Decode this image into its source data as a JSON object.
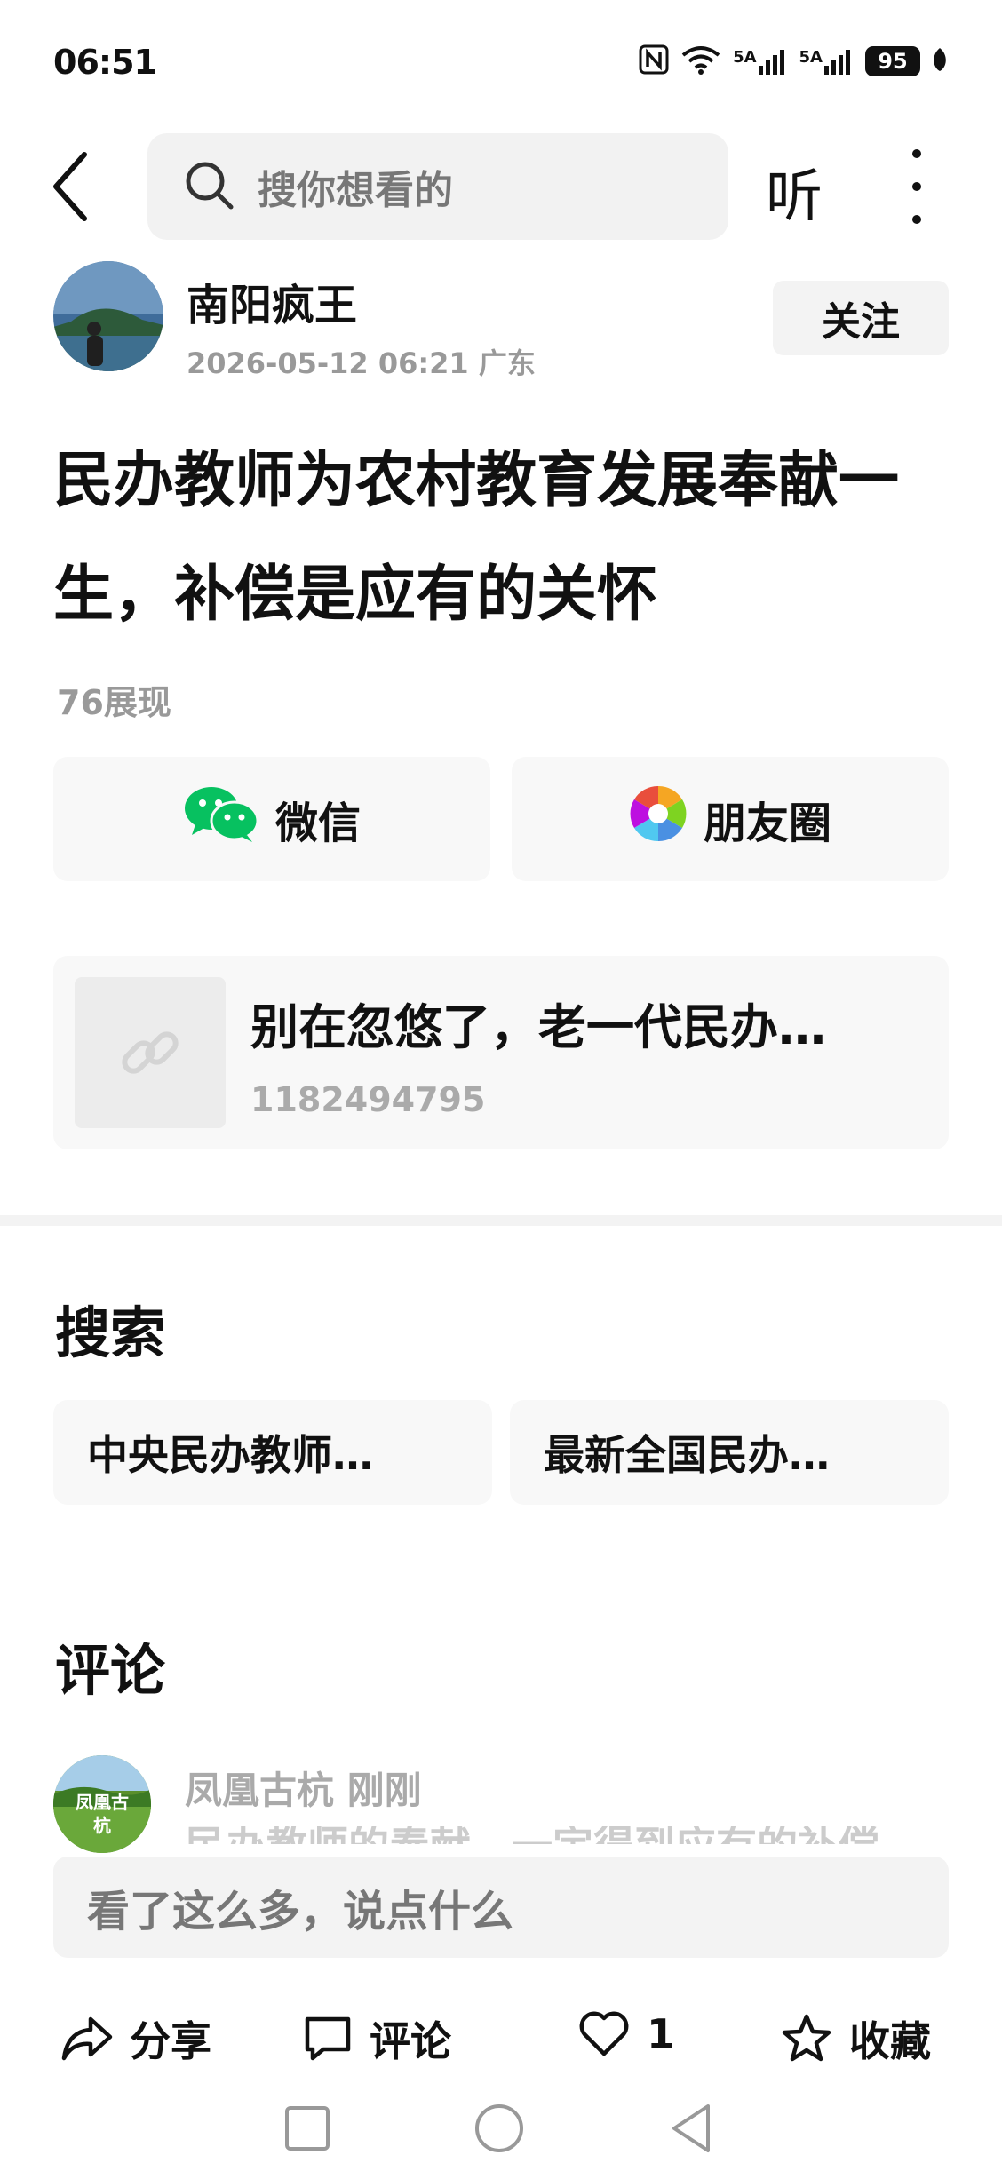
{
  "status_bar": {
    "time": "06:51",
    "network_1": "5A",
    "network_2": "5A",
    "battery": "95"
  },
  "header": {
    "search_placeholder": "搜你想看的",
    "listen_label": "听"
  },
  "author": {
    "name": "南阳疯王",
    "meta": "2026-05-12 06:21 广东",
    "follow_label": "关注"
  },
  "article": {
    "title": "民办教师为农村教育发展奉献一生，补偿是应有的关怀",
    "views": "76展现"
  },
  "share": {
    "wechat_label": "微信",
    "moments_label": "朋友圈"
  },
  "link_card": {
    "title": "别在忽悠了，老一代民办…",
    "subtitle": "1182494795"
  },
  "search_section": {
    "title": "搜索",
    "chips": [
      "中央民办教师…",
      "最新全国民办…"
    ]
  },
  "comments_section": {
    "title": "评论",
    "first_comment": {
      "author_and_time": "凤凰古杭  刚刚",
      "avatar_text": "凤凰古杭",
      "text": "民办教师的奉献，一定得到应有的补偿"
    },
    "input_placeholder": "看了这么多，说点什么"
  },
  "action_bar": {
    "share_label": "分享",
    "comment_label": "评论",
    "like_count": "1",
    "favorite_label": "收藏"
  },
  "colors": {
    "wechat_green": "#07c160",
    "muted_text": "#999999",
    "card_bg": "#f8f8f8"
  }
}
